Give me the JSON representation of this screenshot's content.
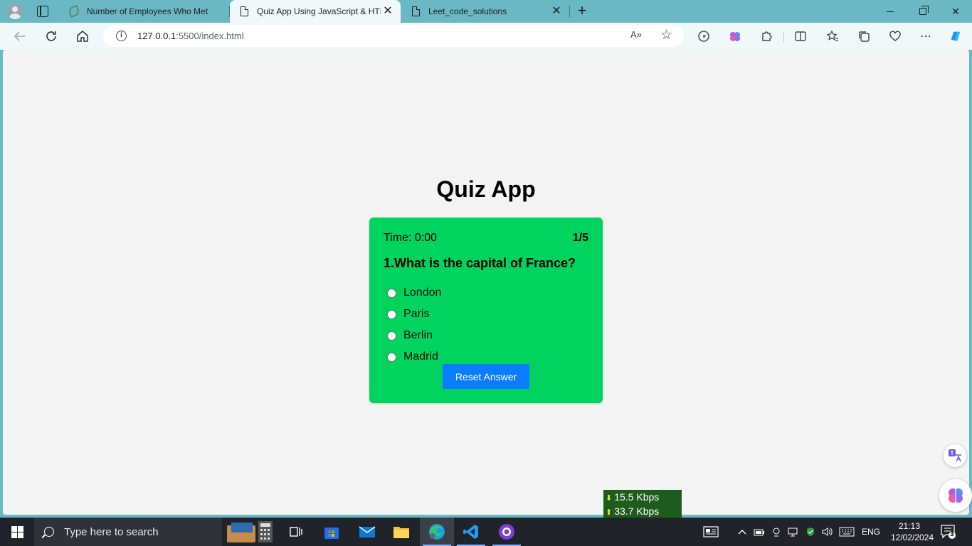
{
  "browser": {
    "tabs": [
      {
        "title": "Number of Employees Who Met"
      },
      {
        "title": "Quiz App Using JavaScript & HTML"
      },
      {
        "title": "Leet_code_solutions"
      }
    ],
    "address": {
      "host": "127.0.0.1",
      "path": ":5500/index.html"
    },
    "read_aloud_label": "A»"
  },
  "page": {
    "title": "Quiz App",
    "quiz": {
      "timer": "Time: 0:00",
      "counter": "1/5",
      "question": "1.What is the capital of France?",
      "options": [
        "London",
        "Paris",
        "Berlin",
        "Madrid"
      ],
      "reset_label": "Reset Answer",
      "card_color": "#00d35e",
      "button_color": "#0a7cff"
    }
  },
  "netspeed": {
    "down": "15.5 Kbps",
    "up": "33.7 Kbps"
  },
  "taskbar": {
    "search_placeholder": "Type here to search",
    "language": "ENG",
    "time": "21:13",
    "date": "12/02/2024",
    "notifications": "3"
  }
}
